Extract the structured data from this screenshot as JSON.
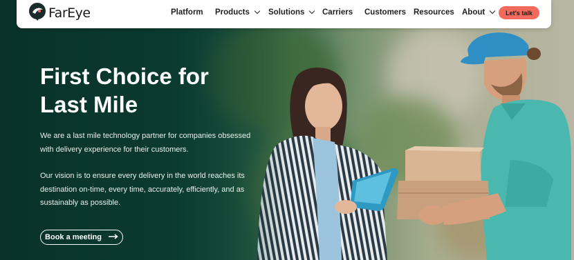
{
  "brand": {
    "name": "FarEye"
  },
  "nav": {
    "items": [
      {
        "label": "Platform",
        "has_dropdown": false
      },
      {
        "label": "Products",
        "has_dropdown": true
      },
      {
        "label": "Solutions",
        "has_dropdown": true
      },
      {
        "label": "Carriers",
        "has_dropdown": false
      },
      {
        "label": "Customers",
        "has_dropdown": false
      },
      {
        "label": "Resources",
        "has_dropdown": false
      },
      {
        "label": "About",
        "has_dropdown": true
      }
    ],
    "cta_label": "Let's talk"
  },
  "hero": {
    "headline": "First Choice for Last Mile",
    "paragraph_1": "We are a last mile technology partner for companies obsessed with delivery experience for their customers.",
    "paragraph_2": "Our vision is to ensure every delivery in the world reaches its destination on-time, every time, accurately, efficiently, and as sustainably as possible.",
    "button_label": "Book a meeting"
  },
  "colors": {
    "hero_dark": "#0a3a31",
    "cta_coral": "#f26a5b",
    "uniform_teal": "#4bb8b0",
    "cap_blue": "#2f8fc4"
  },
  "icons": [
    "logo-icon",
    "chevron-down-icon",
    "arrow-right-icon"
  ]
}
